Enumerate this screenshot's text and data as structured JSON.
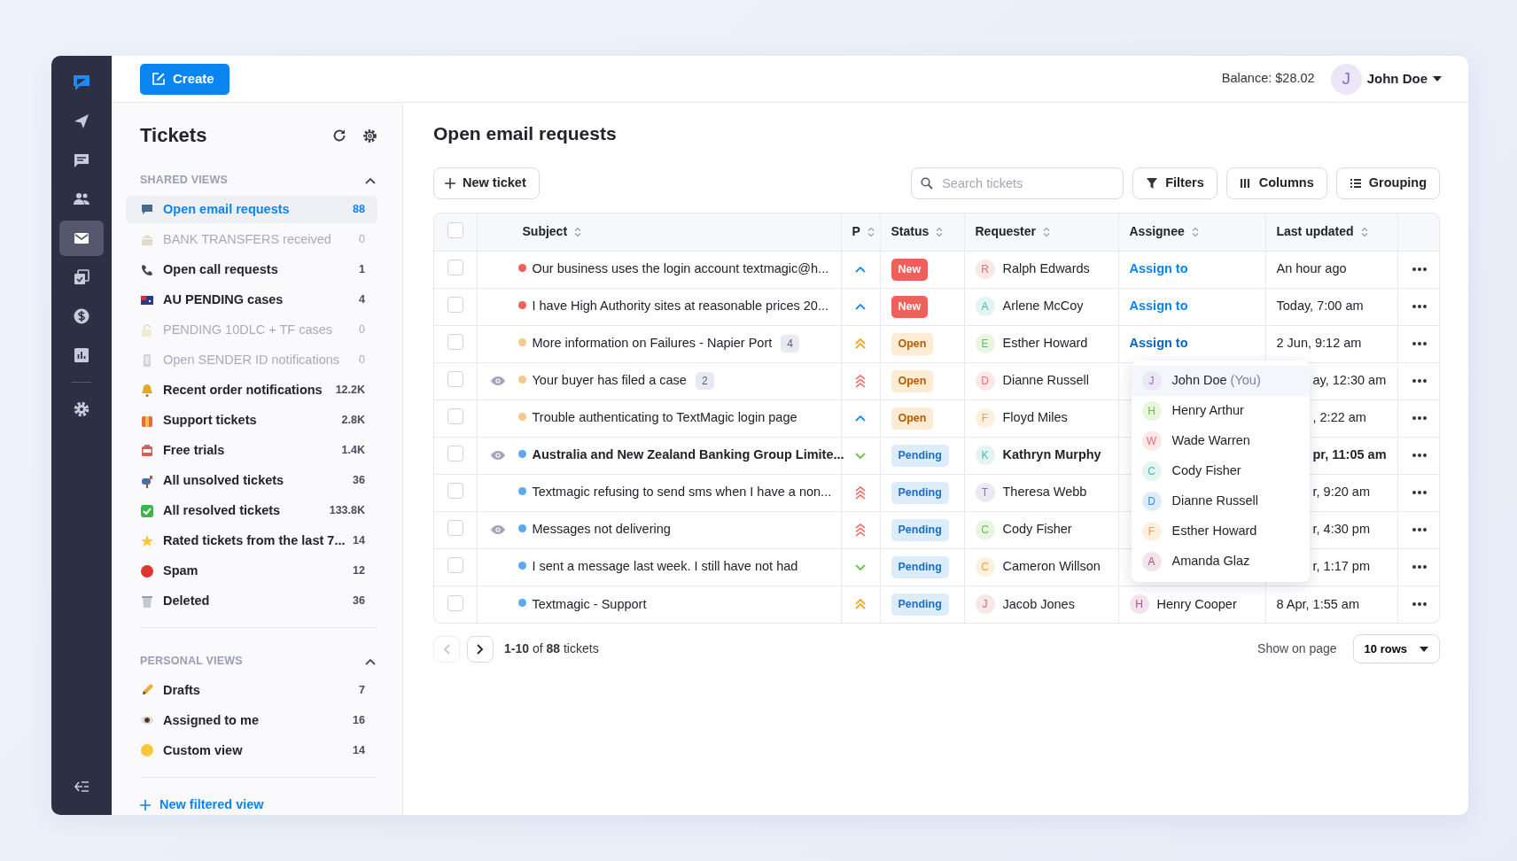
{
  "header": {
    "create_button": "Create",
    "balance": "Balance: $28.02",
    "user": {
      "initial": "J",
      "name": "John Doe"
    }
  },
  "nav_rail": [
    {
      "selected": false
    },
    {
      "selected": false
    },
    {
      "selected": false
    },
    {
      "selected": true
    },
    {
      "selected": false
    },
    {
      "selected": false
    },
    {
      "selected": false
    },
    {
      "selected": false
    }
  ],
  "sidebar": {
    "title": "Tickets",
    "sections": [
      {
        "title": "SHARED VIEWS",
        "expanded": true,
        "items": [
          {
            "label": "Open email requests",
            "count": "88",
            "selected": true,
            "disabled": false
          },
          {
            "label": "BANK TRANSFERS received",
            "count": "0",
            "selected": false,
            "disabled": true
          },
          {
            "label": "Open call requests",
            "count": "1",
            "selected": false,
            "disabled": false
          },
          {
            "label": "AU PENDING cases",
            "count": "4",
            "selected": false,
            "disabled": false
          },
          {
            "label": "PENDING 10DLC + TF cases",
            "count": "0",
            "selected": false,
            "disabled": true
          },
          {
            "label": "Open SENDER ID notifications",
            "count": "0",
            "selected": false,
            "disabled": true
          },
          {
            "label": "Recent order notifications",
            "count": "12.2K",
            "selected": false,
            "disabled": false
          },
          {
            "label": "Support tickets",
            "count": "2.8K",
            "selected": false,
            "disabled": false
          },
          {
            "label": "Free trials",
            "count": "1.4K",
            "selected": false,
            "disabled": false
          },
          {
            "label": "All unsolved tickets",
            "count": "36",
            "selected": false,
            "disabled": false
          },
          {
            "label": "All resolved tickets",
            "count": "133.8K",
            "selected": false,
            "disabled": false
          },
          {
            "label": "Rated tickets from the last 7...",
            "count": "14",
            "selected": false,
            "disabled": false
          },
          {
            "label": "Spam",
            "count": "12",
            "selected": false,
            "disabled": false
          },
          {
            "label": "Deleted",
            "count": "36",
            "selected": false,
            "disabled": false
          }
        ]
      },
      {
        "title": "PERSONAL VIEWS",
        "expanded": true,
        "items": [
          {
            "label": "Drafts",
            "count": "7",
            "selected": false,
            "disabled": false
          },
          {
            "label": "Assigned to me",
            "count": "16",
            "selected": false,
            "disabled": false
          },
          {
            "label": "Custom view",
            "count": "14",
            "selected": false,
            "disabled": false
          }
        ]
      }
    ],
    "new_view": "New filtered view"
  },
  "main": {
    "title": "Open email requests",
    "new_ticket": "New ticket",
    "search": {
      "placeholder": "Search tickets"
    },
    "buttons": [
      "Filters",
      "Columns",
      "Grouping"
    ]
  },
  "table": {
    "select_all": {
      "checked": false
    },
    "columns": [
      "Subject",
      "P",
      "Status",
      "Requester",
      "Assignee",
      "Last updated"
    ],
    "rows": [
      {
        "checked": false,
        "watched": false,
        "color": "#f0605a",
        "subject": "Our business uses the login account textmagic@h...",
        "unread": false,
        "priority": {
          "kind": "up"
        },
        "status": {
          "label": "New",
          "kind": "new"
        },
        "requester": {
          "initial": "R",
          "name": "Ralph Edwards",
          "color": "#e8706c"
        },
        "assignee": {
          "kind": "link",
          "label": "Assign to",
          "expanded": false
        },
        "last_updated": "An hour ago"
      },
      {
        "checked": false,
        "watched": false,
        "color": "#f0605a",
        "subject": "I have High Authority sites at reasonable prices 20...",
        "unread": false,
        "priority": {
          "kind": "up"
        },
        "status": {
          "label": "New",
          "kind": "new"
        },
        "requester": {
          "initial": "A",
          "name": "Arlene McCoy",
          "color": "#4fb8b0"
        },
        "assignee": {
          "kind": "link",
          "label": "Assign to",
          "expanded": false
        },
        "last_updated": "Today, 7:00 am"
      },
      {
        "checked": false,
        "watched": false,
        "color": "#f5c98a",
        "subject": "More information on Failures - Napier Port",
        "replies": "4",
        "unread": false,
        "priority": {
          "kind": "double"
        },
        "status": {
          "label": "Open",
          "kind": "open"
        },
        "requester": {
          "initial": "E",
          "name": "Esther Howard",
          "color": "#6cc04a"
        },
        "assignee": {
          "kind": "link",
          "label": "Assign to",
          "expanded": true
        },
        "last_updated": "2 Jun, 9:12 am"
      },
      {
        "checked": false,
        "watched": true,
        "color": "#f5c98a",
        "subject": "Your buyer has filed a case",
        "replies": "2",
        "unread": false,
        "priority": {
          "kind": "triple"
        },
        "status": {
          "label": "Open",
          "kind": "open"
        },
        "requester": {
          "initial": "D",
          "name": "Dianne Russell",
          "color": "#e8706c"
        },
        "last_updated": "ay, 12:30 am"
      },
      {
        "checked": false,
        "watched": false,
        "color": "#f5c98a",
        "subject": "Trouble authenticating to TextMagic login page",
        "unread": false,
        "priority": {
          "kind": "up"
        },
        "status": {
          "label": "Open",
          "kind": "open"
        },
        "requester": {
          "initial": "F",
          "name": "Floyd Miles",
          "color": "#f2a13a"
        },
        "last_updated": ", 2:22 am"
      },
      {
        "checked": false,
        "watched": true,
        "color": "#5aa9f5",
        "subject": "Australia and New Zealand Banking Group Limite...",
        "unread": true,
        "priority": {
          "kind": "down"
        },
        "status": {
          "label": "Pending",
          "kind": "pending"
        },
        "requester": {
          "initial": "K",
          "name": "Kathryn Murphy",
          "color": "#4fb8b0"
        },
        "last_updated": "pr, 11:05 am"
      },
      {
        "checked": false,
        "watched": false,
        "color": "#5aa9f5",
        "subject": "Textmagic refusing to send sms when I have a non...",
        "unread": false,
        "priority": {
          "kind": "triple"
        },
        "status": {
          "label": "Pending",
          "kind": "pending"
        },
        "requester": {
          "initial": "T",
          "name": "Theresa Webb",
          "color": "#8a6fc9"
        },
        "last_updated": "r, 9:20 am"
      },
      {
        "checked": false,
        "watched": true,
        "color": "#5aa9f5",
        "subject": "Messages not delivering",
        "unread": false,
        "priority": {
          "kind": "triple"
        },
        "status": {
          "label": "Pending",
          "kind": "pending"
        },
        "requester": {
          "initial": "C",
          "name": "Cody Fisher",
          "color": "#6cc04a"
        },
        "last_updated": "r, 4:30 pm"
      },
      {
        "checked": false,
        "watched": false,
        "color": "#5aa9f5",
        "subject": "I sent a message last week. I still have not had",
        "unread": false,
        "priority": {
          "kind": "down"
        },
        "status": {
          "label": "Pending",
          "kind": "pending"
        },
        "requester": {
          "initial": "C",
          "name": "Cameron Willson",
          "color": "#f2a13a"
        },
        "last_updated": "r, 1:17 pm"
      },
      {
        "checked": false,
        "watched": false,
        "color": "#5aa9f5",
        "subject": "Textmagic - Support",
        "unread": false,
        "priority": {
          "kind": "double"
        },
        "status": {
          "label": "Pending",
          "kind": "pending"
        },
        "requester": {
          "initial": "J",
          "name": "Jacob Jones",
          "color": "#c0706c"
        },
        "assignee": {
          "kind": "person",
          "initial": "H",
          "name": "Henry Cooper",
          "color": "#b0508a"
        },
        "last_updated": "8 Apr, 1:55 am"
      }
    ]
  },
  "assign_menu": {
    "items": [
      {
        "initial": "J",
        "name": "John Doe",
        "suffix": "(You)",
        "color": "#8a6fc9",
        "selected": true
      },
      {
        "initial": "H",
        "name": "Henry Arthur",
        "color": "#6cc04a",
        "selected": false
      },
      {
        "initial": "W",
        "name": "Wade Warren",
        "color": "#e8706c",
        "selected": false
      },
      {
        "initial": "C",
        "name": "Cody Fisher",
        "color": "#4fb8b0",
        "selected": false
      },
      {
        "initial": "D",
        "name": "Dianne Russell",
        "color": "#2f8de4",
        "selected": false
      },
      {
        "initial": "F",
        "name": "Esther Howard",
        "color": "#f2a13a",
        "selected": false
      },
      {
        "initial": "A",
        "name": "Amanda Glaz",
        "color": "#b0508a",
        "selected": false
      }
    ]
  },
  "pagination": {
    "previous": {
      "disabled": true
    },
    "next": {
      "disabled": false
    },
    "summary": "**1-10** of **88** tickets",
    "page_size_label": "Show on page",
    "page_size": "10 rows"
  }
}
